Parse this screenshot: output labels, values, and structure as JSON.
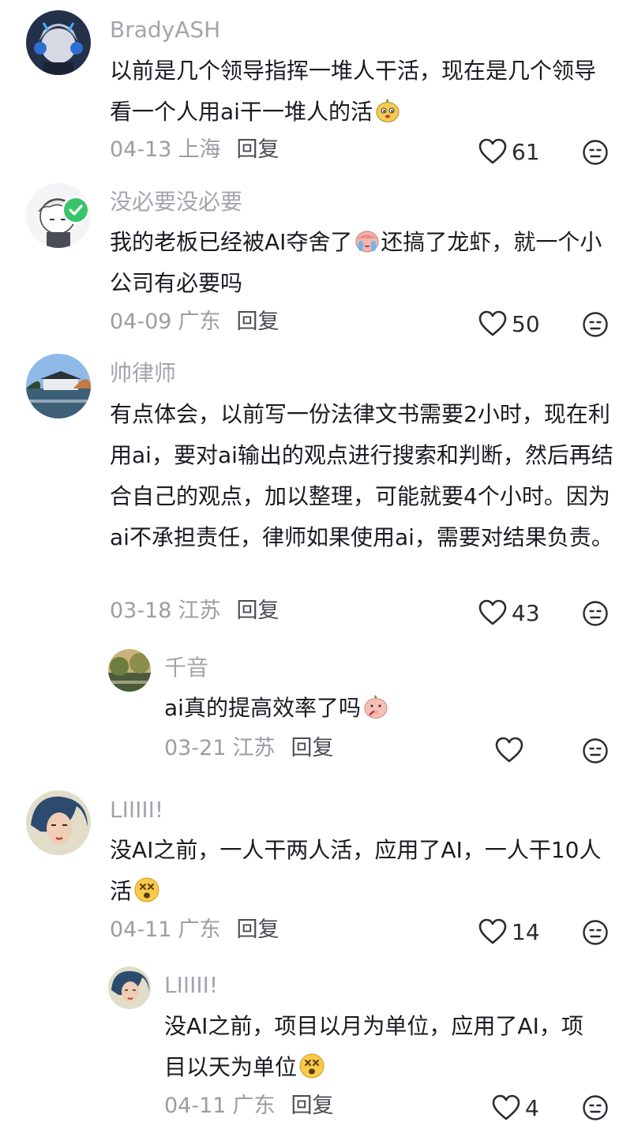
{
  "comments": [
    {
      "username": "BradyASH",
      "text": "以前是几个领导指挥一堆人干活，现在是几个领导看一个人用ai干一堆人的活",
      "date": "04-13",
      "location": "上海",
      "reply_label": "回复",
      "likes": "61",
      "emoji": "smirk-emoji"
    },
    {
      "username": "没必要没必要",
      "text_part1": "我的老板已经被AI夺舍了",
      "text_part2": "还搞了龙虾，就一个小公司有必要吗",
      "date": "04-09",
      "location": "广东",
      "reply_label": "回复",
      "likes": "50",
      "emoji": "crying-emoji"
    },
    {
      "username": "帅律师",
      "text": "有点体会，以前写一份法律文书需要2小时，现在利用ai，要对ai输出的观点进行搜索和判断，然后再结合自己的观点，加以整理，可能就要4个小时。因为ai不承担责任，律师如果使用ai，需要对结果负责。",
      "date": "03-18",
      "location": "江苏",
      "reply_label": "回复",
      "likes": "43"
    },
    {
      "username": "千音",
      "text": "ai真的提高效率了吗",
      "date": "03-21",
      "location": "江苏",
      "reply_label": "回复",
      "likes": "",
      "emoji": "thinking-emoji"
    },
    {
      "username": "LIIIII!",
      "text": "没AI之前，一人干两人活，应用了AI，一人干10人活",
      "date": "04-11",
      "location": "广东",
      "reply_label": "回复",
      "likes": "14",
      "emoji": "dizzy-emoji"
    },
    {
      "username": "LIIIII!",
      "text": "没AI之前，项目以月为单位，应用了AI，项目以天为单位",
      "date": "04-11",
      "location": "广东",
      "reply_label": "回复",
      "likes": "4",
      "emoji": "dizzy-emoji"
    }
  ]
}
